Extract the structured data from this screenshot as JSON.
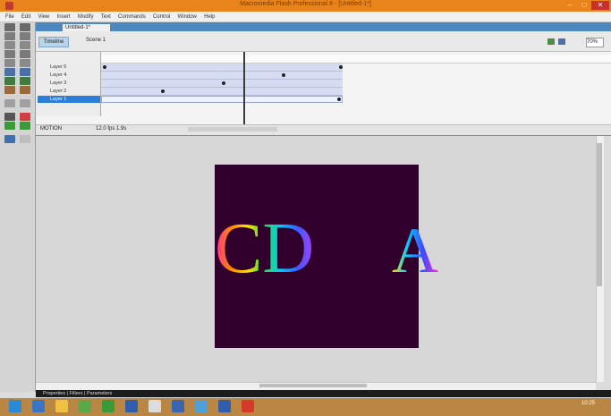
{
  "window": {
    "title": "Macromedia Flash Professional 8 - [Untitled-1*]"
  },
  "menu": [
    "File",
    "Edit",
    "View",
    "Insert",
    "Modify",
    "Text",
    "Commands",
    "Control",
    "Window",
    "Help"
  ],
  "document_tab": "Untitled-1*",
  "edit_bar": {
    "timeline_tab": "Timeline",
    "scene": "Scene 1",
    "zoom": "70%"
  },
  "layers": [
    {
      "name": "Layer 5"
    },
    {
      "name": "Layer 4"
    },
    {
      "name": "Layer 3"
    },
    {
      "name": "Layer 2"
    },
    {
      "name": "Layer 1"
    }
  ],
  "timeline_footer": {
    "label": "MOTION",
    "controls": "12.0 fps  1.9s"
  },
  "stage": {
    "text_left": "CD",
    "text_right": "A",
    "background": "#32002d"
  },
  "status_bar": "Properties | Filters | Parameters",
  "taskbar": {
    "time": "10:25"
  }
}
